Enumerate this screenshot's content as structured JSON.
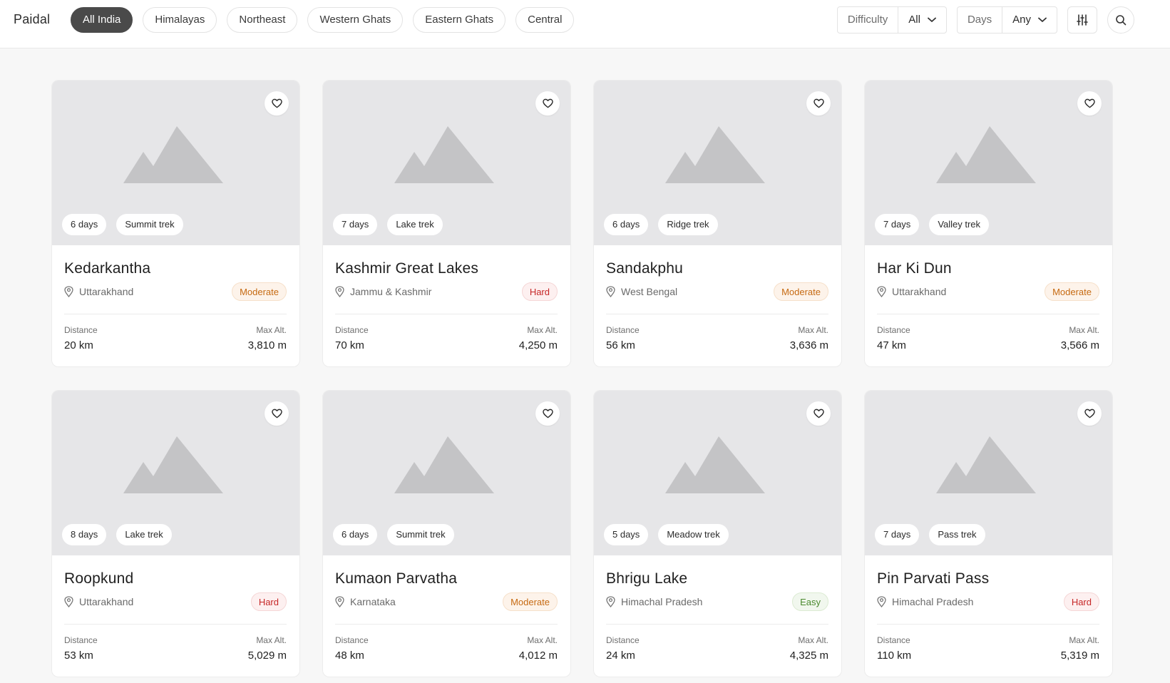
{
  "app": {
    "brand": "Paidal"
  },
  "regions": [
    "All India",
    "Himalayas",
    "Northeast",
    "Western Ghats",
    "Eastern Ghats",
    "Central"
  ],
  "active_region": 0,
  "filters": {
    "difficulty_label": "Difficulty",
    "difficulty_value": "All",
    "days_label": "Days",
    "days_value": "Any",
    "adjust_icon": "sliders-icon",
    "search_icon": "search-icon"
  },
  "stats_labels": {
    "distance": "Distance",
    "max_alt": "Max Alt."
  },
  "colors": {
    "moderate": "#c66a12",
    "hard": "#c62828",
    "easy": "#4b8a2f",
    "active_pill": "#4a4a4a"
  },
  "treks": [
    {
      "name": "Kedarkantha",
      "location": "Uttarakhand",
      "difficulty": "Moderate",
      "level": "moderate",
      "days": "6 days",
      "type": "Summit trek",
      "distance": "20 km",
      "max_alt": "3,810 m"
    },
    {
      "name": "Kashmir Great Lakes",
      "location": "Jammu & Kashmir",
      "difficulty": "Hard",
      "level": "hard",
      "days": "7 days",
      "type": "Lake trek",
      "distance": "70 km",
      "max_alt": "4,250 m"
    },
    {
      "name": "Sandakphu",
      "location": "West Bengal",
      "difficulty": "Moderate",
      "level": "moderate",
      "days": "6 days",
      "type": "Ridge trek",
      "distance": "56 km",
      "max_alt": "3,636 m"
    },
    {
      "name": "Har Ki Dun",
      "location": "Uttarakhand",
      "difficulty": "Moderate",
      "level": "moderate",
      "days": "7 days",
      "type": "Valley trek",
      "distance": "47 km",
      "max_alt": "3,566 m"
    },
    {
      "name": "Roopkund",
      "location": "Uttarakhand",
      "difficulty": "Hard",
      "level": "hard",
      "days": "8 days",
      "type": "Lake trek",
      "distance": "53 km",
      "max_alt": "5,029 m"
    },
    {
      "name": "Kumaon Parvatha",
      "location": "Karnataka",
      "difficulty": "Moderate",
      "level": "moderate",
      "days": "6 days",
      "type": "Summit trek",
      "distance": "48 km",
      "max_alt": "4,012 m"
    },
    {
      "name": "Bhrigu Lake",
      "location": "Himachal Pradesh",
      "difficulty": "Easy",
      "level": "easy",
      "days": "5 days",
      "type": "Meadow trek",
      "distance": "24 km",
      "max_alt": "4,325 m"
    },
    {
      "name": "Pin Parvati Pass",
      "location": "Himachal Pradesh",
      "difficulty": "Hard",
      "level": "hard",
      "days": "7 days",
      "type": "Pass trek",
      "distance": "110 km",
      "max_alt": "5,319 m"
    }
  ]
}
